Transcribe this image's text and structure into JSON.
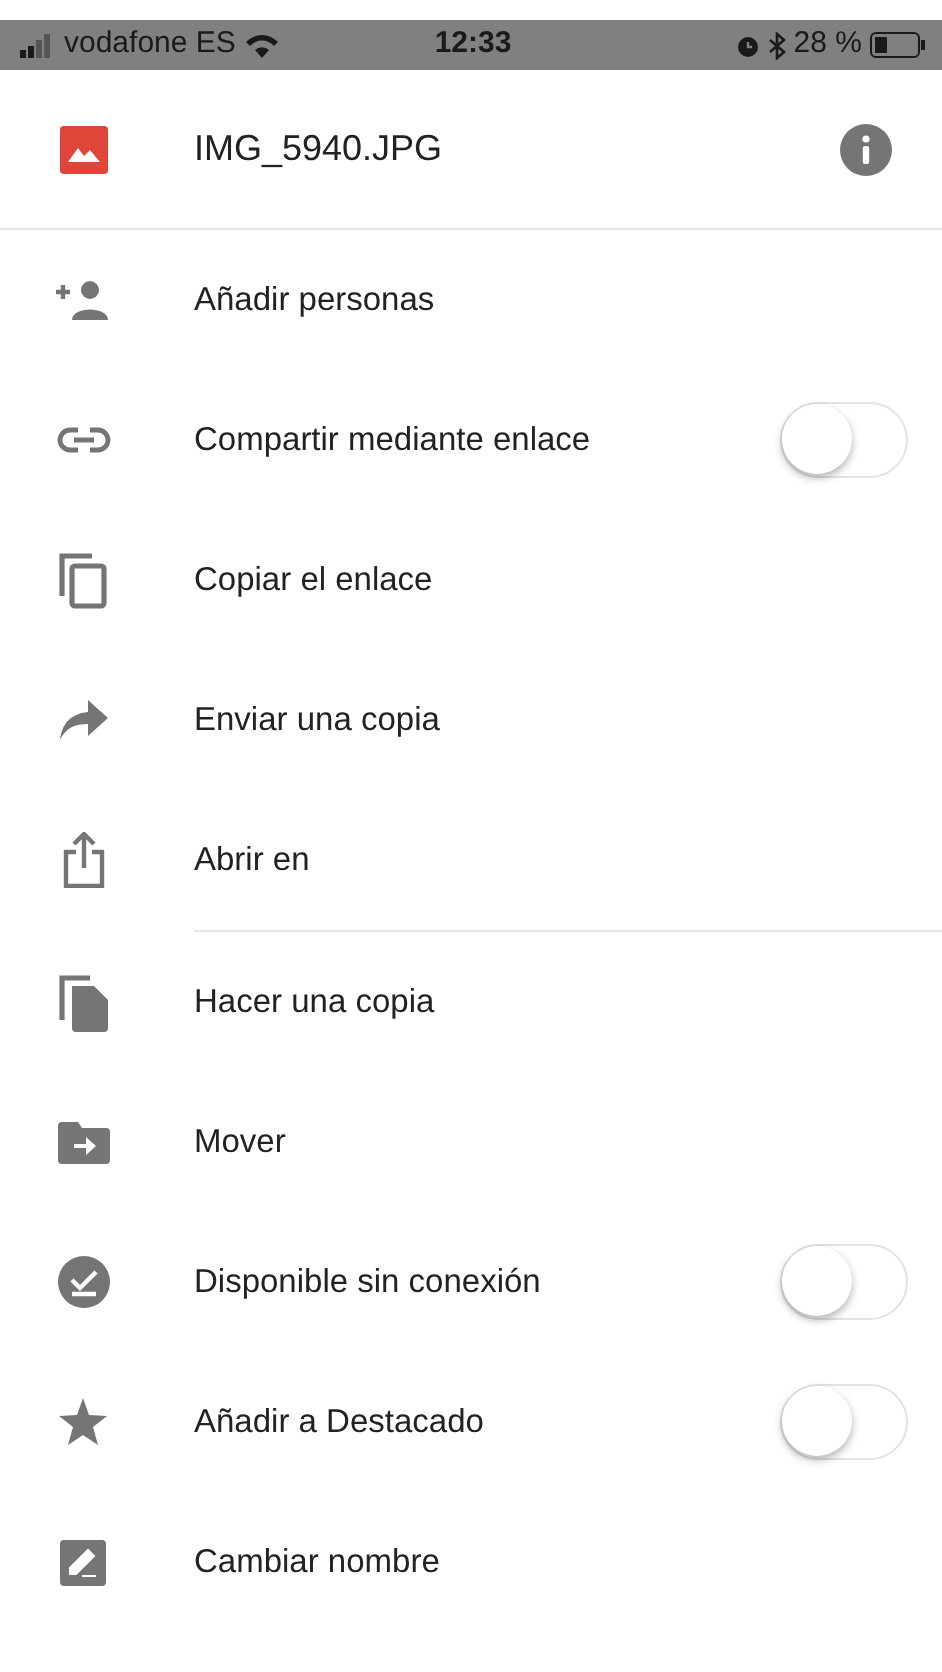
{
  "status_bar": {
    "carrier": "vodafone ES",
    "time": "12:33",
    "battery": "28 %"
  },
  "header": {
    "title": "IMG_5940.JPG"
  },
  "sections": [
    {
      "items": [
        {
          "label": "Añadir personas",
          "kind": "action"
        },
        {
          "label": "Compartir mediante enlace",
          "kind": "toggle",
          "on": false
        },
        {
          "label": "Copiar el enlace",
          "kind": "action"
        },
        {
          "label": "Enviar una copia",
          "kind": "action"
        },
        {
          "label": "Abrir en",
          "kind": "action"
        }
      ]
    },
    {
      "items": [
        {
          "label": "Hacer una copia",
          "kind": "action"
        },
        {
          "label": "Mover",
          "kind": "action"
        },
        {
          "label": "Disponible sin conexión",
          "kind": "toggle",
          "on": false
        },
        {
          "label": "Añadir a Destacado",
          "kind": "toggle",
          "on": false
        },
        {
          "label": "Cambiar nombre",
          "kind": "action"
        }
      ]
    }
  ]
}
